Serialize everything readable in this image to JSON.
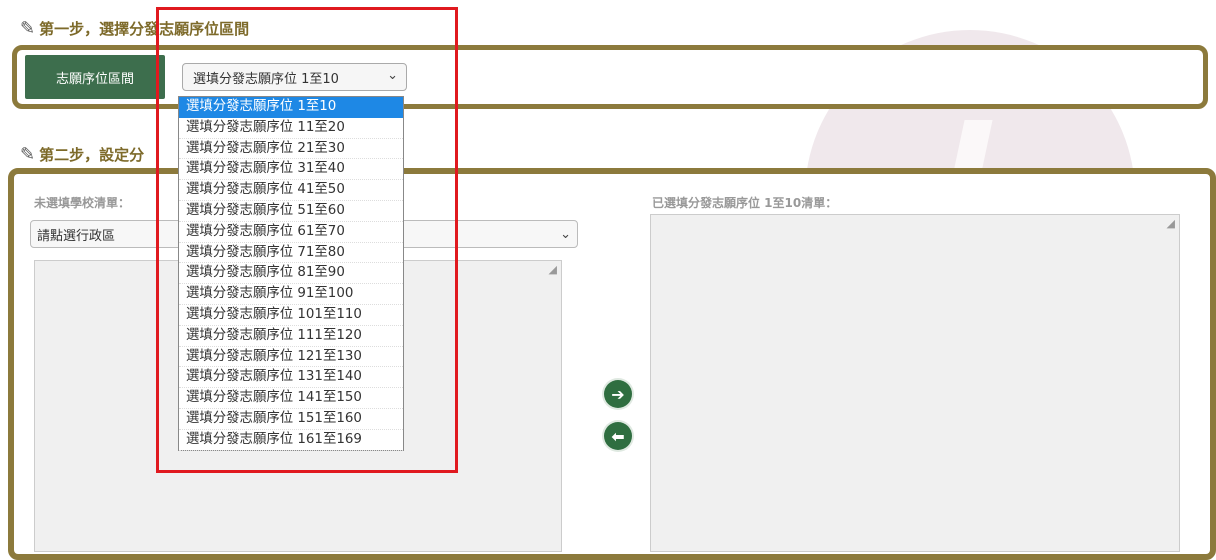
{
  "step1": {
    "title": "第一步，選擇分發志願序位區間"
  },
  "step2": {
    "title": "第二步，設定分"
  },
  "range_select": {
    "label": "志願序位區間",
    "value": "選填分發志願序位 1至10",
    "options": [
      "選填分發志願序位 1至10",
      "選填分發志願序位 11至20",
      "選填分發志願序位 21至30",
      "選填分發志願序位 31至40",
      "選填分發志願序位 41至50",
      "選填分發志願序位 51至60",
      "選填分發志願序位 61至70",
      "選填分發志願序位 71至80",
      "選填分發志願序位 81至90",
      "選填分發志願序位 91至100",
      "選填分發志願序位 101至110",
      "選填分發志願序位 111至120",
      "選填分發志願序位 121至130",
      "選填分發志願序位 131至140",
      "選填分發志願序位 141至150",
      "選填分發志願序位 151至160",
      "選填分發志願序位 161至169"
    ]
  },
  "left": {
    "label": "未選填學校清單：",
    "district_value": "請點選行政區"
  },
  "right": {
    "label": "已選填分發志願序位 1至10清單："
  },
  "colors": {
    "panel_border": "#8c7a3c",
    "label_bg": "#3d6e4d",
    "button_bg": "#2f6e40",
    "selected_option": "#1e88e5",
    "highlight_box": "#e0191f"
  }
}
